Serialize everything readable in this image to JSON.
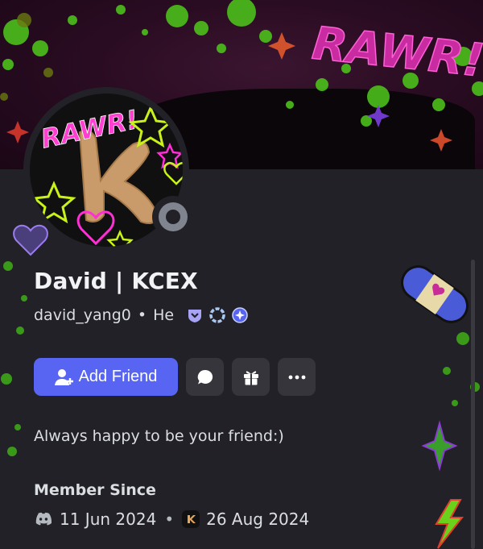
{
  "banner": {
    "graffiti_text": "RAWR!"
  },
  "avatar": {
    "sticker_text": "RAWR!",
    "status": "offline"
  },
  "profile": {
    "display_name": "David | KCEX",
    "username": "david_yang0",
    "separator": "•",
    "pronouns": "He",
    "badges": [
      "nitro-icon",
      "server-booster-icon",
      "quest-icon"
    ]
  },
  "actions": {
    "add_friend_label": "Add Friend",
    "message_icon": "chat-bubble-icon",
    "gift_icon": "gift-icon",
    "more_icon": "more-icon"
  },
  "bio": "Always happy to be your friend:)",
  "member_since": {
    "title": "Member Since",
    "discord_date": "11 Jun 2024",
    "separator": "•",
    "server_date": "26 Aug 2024"
  },
  "colors": {
    "accent": "#5865f2",
    "background": "#232128",
    "button": "#36353c",
    "neon_pink": "#ff2fd6",
    "neon_green": "#8fe21a",
    "status_offline": "#80848e"
  }
}
